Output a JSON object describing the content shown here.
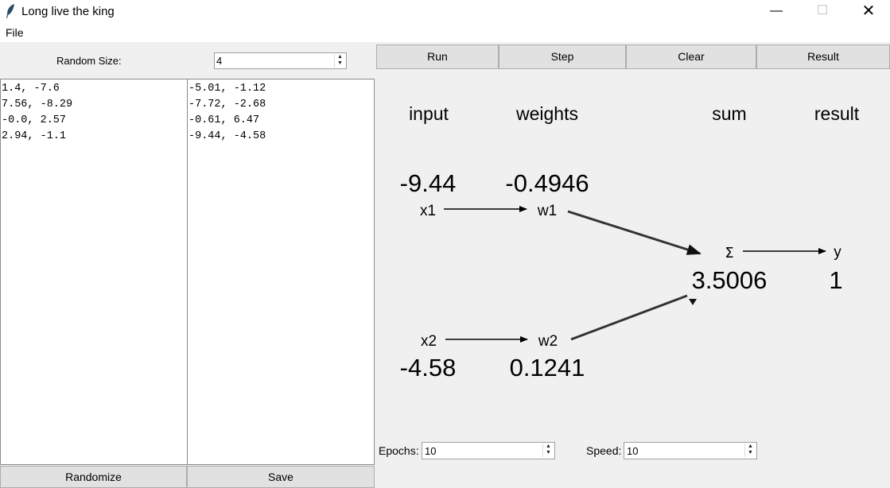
{
  "window": {
    "title": "Long live the king",
    "min_glyph": "—",
    "max_glyph": "☐",
    "close_glyph": "✕",
    "icon": "feather-icon"
  },
  "menu": {
    "file": "File"
  },
  "left": {
    "random_size_label": "Random Size:",
    "random_size_value": "4",
    "list_left": [
      "1.4, -7.6",
      "7.56, -8.29",
      "-0.0, 2.57",
      "2.94, -1.1"
    ],
    "list_right": [
      "-5.01, -1.12",
      "-7.72, -2.68",
      "-0.61, 6.47",
      "-9.44, -4.58"
    ],
    "randomize_label": "Randomize",
    "save_label": "Save"
  },
  "toolbar": {
    "run": "Run",
    "step": "Step",
    "clear": "Clear",
    "result": "Result"
  },
  "diagram": {
    "headers": {
      "input": "input",
      "weights": "weights",
      "sum": "sum",
      "result": "result"
    },
    "x1_value": "-9.44",
    "w1_value": "-0.4946",
    "x2_value": "-4.58",
    "w2_value": "0.1241",
    "x1_label": "x1",
    "w1_label": "w1",
    "x2_label": "x2",
    "w2_label": "w2",
    "sigma_label": "Σ",
    "y_label": "y",
    "sum_value": "3.5006",
    "result_value": "1"
  },
  "controls": {
    "epochs_label": "Epochs:",
    "epochs_value": "10",
    "speed_label": "Speed:",
    "speed_value": "10"
  }
}
